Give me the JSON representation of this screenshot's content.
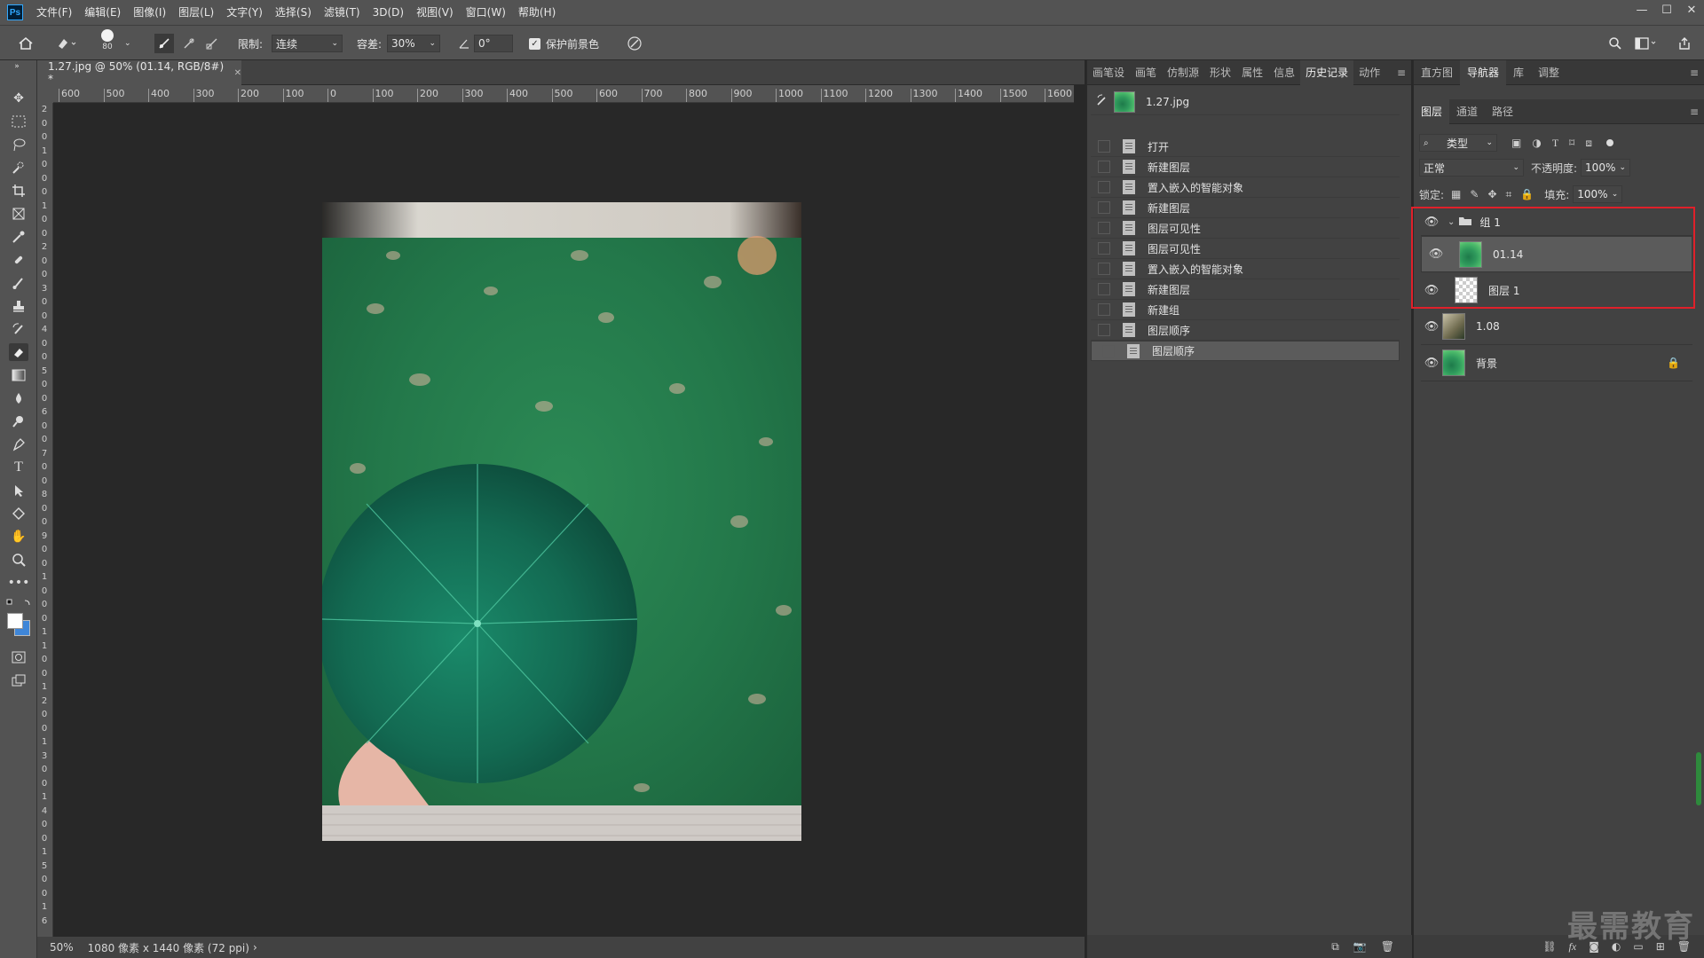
{
  "app": {
    "logo": "Ps"
  },
  "menu": [
    "文件(F)",
    "编辑(E)",
    "图像(I)",
    "图层(L)",
    "文字(Y)",
    "选择(S)",
    "滤镜(T)",
    "3D(D)",
    "视图(V)",
    "窗口(W)",
    "帮助(H)"
  ],
  "window_controls": {
    "minimize": "—",
    "maximize": "☐",
    "close": "✕"
  },
  "options": {
    "brush_size": "80",
    "limit_label": "限制:",
    "limit_value": "连续",
    "tolerance_label": "容差:",
    "tolerance_value": "30%",
    "angle_value": "0°",
    "protect_label": "保护前景色",
    "protect_checked": true
  },
  "document": {
    "tab_title": "1.27.jpg @ 50% (01.14, RGB/8#) *",
    "zoom": "50%",
    "info": "1080 像素 x 1440 像素 (72 ppi)"
  },
  "ruler": {
    "h_labels": [
      "600",
      "500",
      "400",
      "300",
      "200",
      "100",
      "0",
      "100",
      "200",
      "300",
      "400",
      "500",
      "600",
      "700",
      "800",
      "900",
      "1000",
      "1100",
      "1200",
      "1300",
      "1400",
      "1500",
      "1600"
    ],
    "v_labels": [
      "2",
      "0",
      "0",
      "1",
      "0",
      "0",
      "0",
      "1",
      "0",
      "0",
      "2",
      "0",
      "0",
      "3",
      "0",
      "0",
      "4",
      "0",
      "0",
      "5",
      "0",
      "0",
      "6",
      "0",
      "0",
      "7",
      "0",
      "0",
      "8",
      "0",
      "0",
      "9",
      "0",
      "0",
      "1",
      "0",
      "0",
      "0",
      "1",
      "1",
      "0",
      "0",
      "1",
      "2",
      "0",
      "0",
      "1",
      "3",
      "0",
      "0",
      "1",
      "4",
      "0",
      "0",
      "1",
      "5",
      "0",
      "0",
      "1",
      "6"
    ]
  },
  "mid_panel": {
    "tabs": [
      "画笔设",
      "画笔",
      "仿制源",
      "形状",
      "属性",
      "信息",
      "历史记录",
      "动作"
    ],
    "active_tab": "历史记录",
    "snapshot": "1.27.jpg",
    "history": [
      "打开",
      "新建图层",
      "置入嵌入的智能对象",
      "新建图层",
      "图层可见性",
      "图层可见性",
      "置入嵌入的智能对象",
      "新建图层",
      "新建组",
      "图层顺序",
      "图层顺序"
    ]
  },
  "right_panel": {
    "top_tabs": [
      "直方图",
      "导航器",
      "库",
      "调整"
    ],
    "active_top_tab": "导航器",
    "layer_tabs": [
      "图层",
      "通道",
      "路径"
    ],
    "active_layer_tab": "图层",
    "filter_label": "类型",
    "blend_mode": "正常",
    "opacity_label": "不透明度:",
    "opacity_value": "100%",
    "lock_label": "锁定:",
    "fill_label": "填充:",
    "fill_value": "100%",
    "layers": [
      {
        "name": "组 1",
        "kind": "group"
      },
      {
        "name": "01.14",
        "kind": "image",
        "selected": true
      },
      {
        "name": "图层 1",
        "kind": "empty"
      },
      {
        "name": "1.08",
        "kind": "image"
      },
      {
        "name": "背景",
        "kind": "background",
        "locked": true
      }
    ]
  },
  "watermark": "最需教育",
  "colors": {
    "highlight_box": "#e0202a",
    "fg": "#ffffff",
    "bg": "#3f86d8"
  }
}
